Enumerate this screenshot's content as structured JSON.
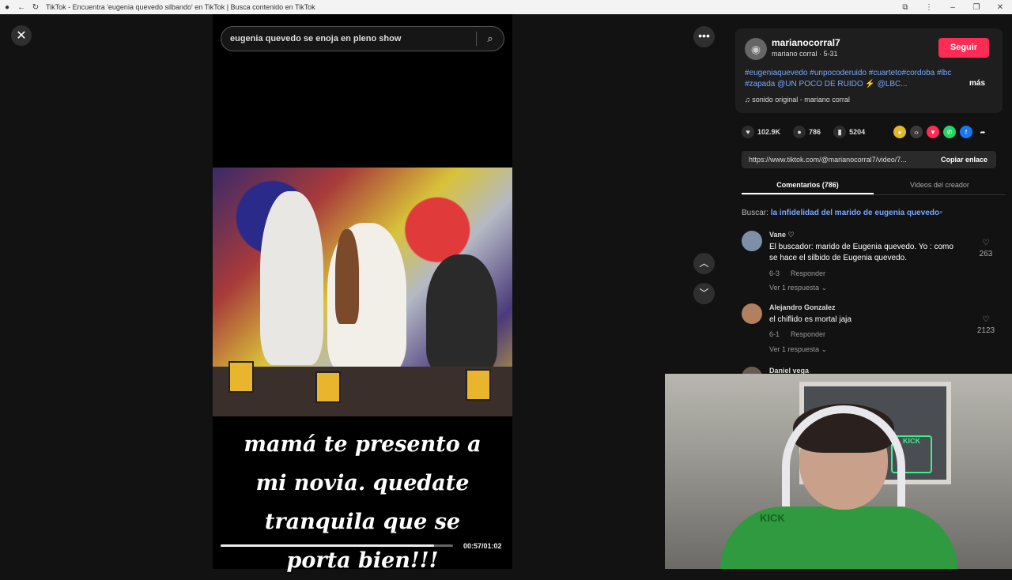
{
  "browser": {
    "window_title": "TikTok - Encuentra 'eugenia quevedo silbando' en TikTok | Busca contenido en TikTok"
  },
  "search": {
    "query": "eugenia quevedo se enoja en pleno show"
  },
  "video": {
    "caption_lines": [
      "mamá te presento a",
      "mi novia. quedate",
      "tranquila que se",
      "porta bien!!!"
    ],
    "time": "00:57/01:02",
    "progress": 0.92
  },
  "author": {
    "username": "marianocorral7",
    "subtitle": "mariano corral · 5-31",
    "follow_label": "Seguir",
    "description": "#eugeniaquevedo #unpocoderuido #cuarteto#cordoba #lbc #zapada @UN POCO DE RUIDO ⚡ @LBC...",
    "more_label": "más",
    "sound": "sonido original - mariano corral"
  },
  "stats": {
    "likes": "102.9K",
    "comments": "786",
    "saves": "5204"
  },
  "link": {
    "url": "https://www.tiktok.com/@marianocorral7/video/7...",
    "copy_label": "Copiar enlace"
  },
  "tabs": {
    "comments": "Comentarios (786)",
    "creator_videos": "Videos del creador"
  },
  "suggestion": {
    "label": "Buscar:",
    "query": "la infidelidad del marido de eugenia quevedo"
  },
  "comments": [
    {
      "user": "Vane",
      "text": "El buscador: marido de Eugenia quevedo. Yo : como se hace el silbido de Eugenia quevedo.",
      "date": "6-3",
      "reply_label": "Responder",
      "replies": "Ver 1 respuesta",
      "likes": "263"
    },
    {
      "user": "Alejandro Gonzalez",
      "text": "el chiflido es mortal jaja",
      "date": "6-1",
      "reply_label": "Responder",
      "replies": "Ver 1 respuesta",
      "likes": "2123"
    },
    {
      "user": "Daniel vega"
    }
  ],
  "webcam": {
    "shirt_text": "KICK",
    "neon_text": "KICK"
  },
  "icons": {
    "close": "close-icon",
    "more": "more-icon",
    "up": "chevron-up-icon",
    "down": "chevron-down-icon",
    "heart": "heart-icon",
    "comment": "comment-icon",
    "bookmark": "bookmark-icon",
    "search": "search-icon"
  }
}
